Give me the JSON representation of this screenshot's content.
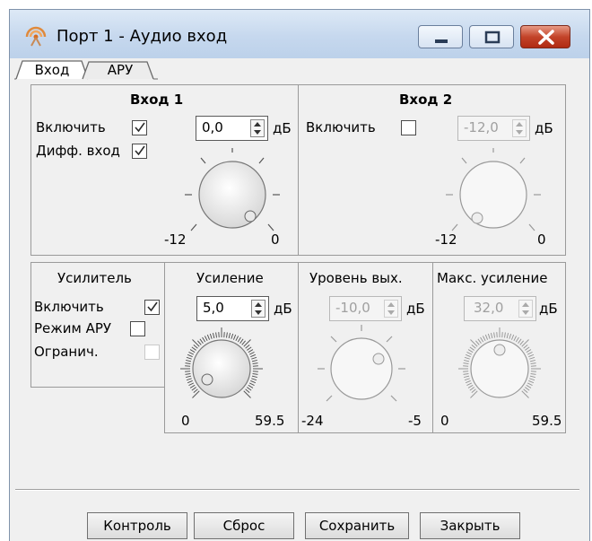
{
  "window": {
    "title": "Порт 1 - Аудио вход",
    "icon": "antenna-icon",
    "controls": {
      "minimize": "minimize-icon",
      "maximize": "maximize-icon",
      "close": "close-icon"
    },
    "close_color": "#c3442a"
  },
  "tabs": [
    {
      "label": "Вход",
      "active": true
    },
    {
      "label": "АРУ",
      "active": false
    }
  ],
  "input1": {
    "title": "Вход 1",
    "enable_label": "Включить",
    "enable_checked": true,
    "diff_label": "Дифф. вход",
    "diff_checked": true,
    "value": "0,0",
    "unit": "дБ",
    "min": "-12",
    "max": "0"
  },
  "input2": {
    "title": "Вход 2",
    "enable_label": "Включить",
    "enable_checked": false,
    "value": "-12,0",
    "unit": "дБ",
    "min": "-12",
    "max": "0"
  },
  "amplifier": {
    "title": "Усилитель",
    "enable_label": "Включить",
    "enable_checked": true,
    "agc_label": "Режим АРУ",
    "agc_checked": false,
    "limit_label": "Огранич.",
    "limit_checked": false
  },
  "gain": {
    "title": "Усиление",
    "value": "5,0",
    "unit": "дБ",
    "min": "0",
    "max": "59.5"
  },
  "output_level": {
    "title": "Уровень вых.",
    "value": "-10,0",
    "unit": "дБ",
    "min": "-24",
    "max": "-5"
  },
  "max_gain": {
    "title": "Макс. усиление",
    "value": "32,0",
    "unit": "дБ",
    "min": "0",
    "max": "59.5"
  },
  "buttons": {
    "control": "Контроль",
    "reset": "Сброс",
    "save": "Сохранить",
    "close": "Закрыть"
  }
}
